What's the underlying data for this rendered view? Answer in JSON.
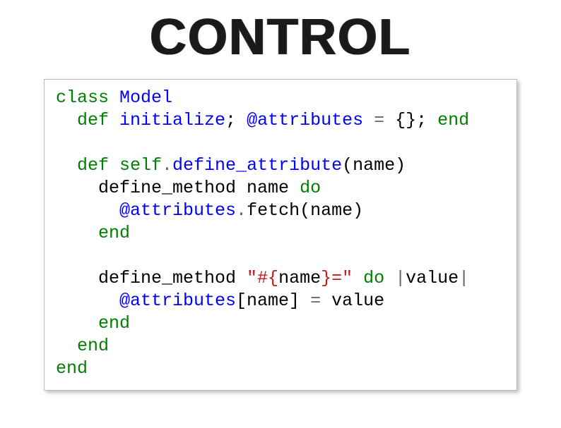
{
  "title": "CONTROL",
  "code": {
    "l1_class": "class",
    "l1_model": " Model",
    "l2_def": "  def",
    "l2_init": " initialize",
    "l2_semi": ";",
    "l2_ivar": " @attributes",
    "l2_eq": " = ",
    "l2_braces": "{};",
    "l2_end": " end",
    "l4_def": "  def",
    "l4_self": " self",
    "l4_dot": ".",
    "l4_defattr": "define_attribute",
    "l4_paren": "(name)",
    "l5_dm": "    define_method name ",
    "l5_do": "do",
    "l6_ivar": "      @attributes",
    "l6_dot": ".",
    "l6_fetch": "fetch(name)",
    "l7_end": "    end",
    "l9_dm": "    define_method ",
    "l9_str1": "\"#{",
    "l9_name": "name",
    "l9_str2": "}",
    "l9_str3": "=\"",
    "l9_sp": " ",
    "l9_do": "do",
    "l9_pipe": " |",
    "l9_val": "value",
    "l9_pipe2": "|",
    "l10_ivar": "      @attributes",
    "l10_br": "[name] ",
    "l10_eq": "=",
    "l10_val": " value",
    "l11_end": "    end",
    "l12_end": "  end",
    "l13_end": "end"
  }
}
